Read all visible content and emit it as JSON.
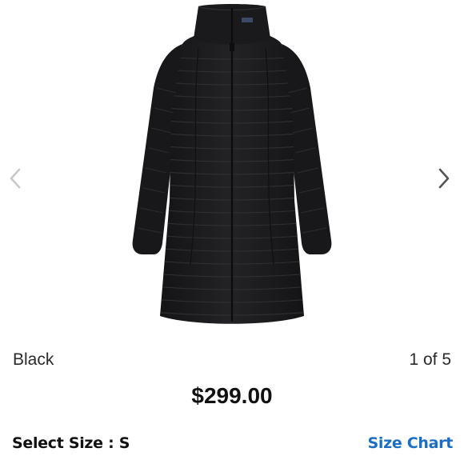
{
  "gallery": {
    "prev_icon": "chevron-left-icon",
    "next_icon": "chevron-right-icon",
    "image_subject": "black quilted long down jacket",
    "counter": "1 of 5"
  },
  "product": {
    "color": "Black",
    "price": "$299.00"
  },
  "size": {
    "label": "Select Size : S",
    "chart_link": "Size Chart"
  },
  "colors": {
    "jacket": "#1c1c1e",
    "chevron_prev": "#c8c8cc",
    "chevron_next": "#555555",
    "link": "#1a6fc4"
  }
}
